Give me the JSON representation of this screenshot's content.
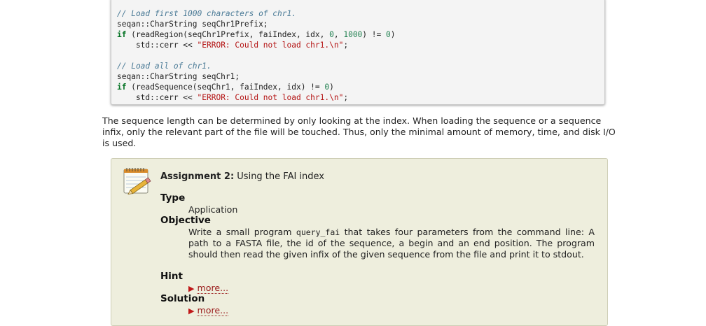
{
  "code": {
    "block1": {
      "comment": "// Load first 1000 characters of chr1.",
      "decl": "seqan::CharString seqChr1Prefix;",
      "if_kw": "if",
      "if_open": " (readRegion(seqChr1Prefix, faiIndex, idx, ",
      "num0": "0",
      "comma": ", ",
      "num1000": "1000",
      "if_close": ") != ",
      "zero": "0",
      "paren": ")",
      "cerr": "    std::cerr << ",
      "str": "\"ERROR: Could not load chr1.\\n\"",
      "semi": ";"
    },
    "block2": {
      "comment": "// Load all of chr1.",
      "decl": "seqan::CharString seqChr1;",
      "if_kw": "if",
      "if_open": " (readSequence(seqChr1, faiIndex, idx) != ",
      "zero": "0",
      "paren": ")",
      "cerr": "    std::cerr << ",
      "str": "\"ERROR: Could not load chr1.\\n\"",
      "semi": ";"
    }
  },
  "paragraph": "The sequence length can be determined by only looking at the index. When loading the sequence or a sequence infix, only the relevant part of the file will be touched. Thus, only the minimal amount of memory, time, and disk I/O is used.",
  "assignment": {
    "title_bold": "Assignment 2:",
    "title_rest": " Using the FAI index",
    "type_label": "Type",
    "type_value": "Application",
    "objective_label": "Objective",
    "objective_pre": "Write a small program ",
    "objective_code": "query_fai",
    "objective_post": " that takes four parameters from the command line: A path to a FASTA file, the id of the sequence, a begin and an end position. The program should then read the given infix of the given sequence from the file and print it to stdout.",
    "hint_label": "Hint",
    "hint_link": "more...",
    "solution_label": "Solution",
    "solution_link": "more..."
  }
}
